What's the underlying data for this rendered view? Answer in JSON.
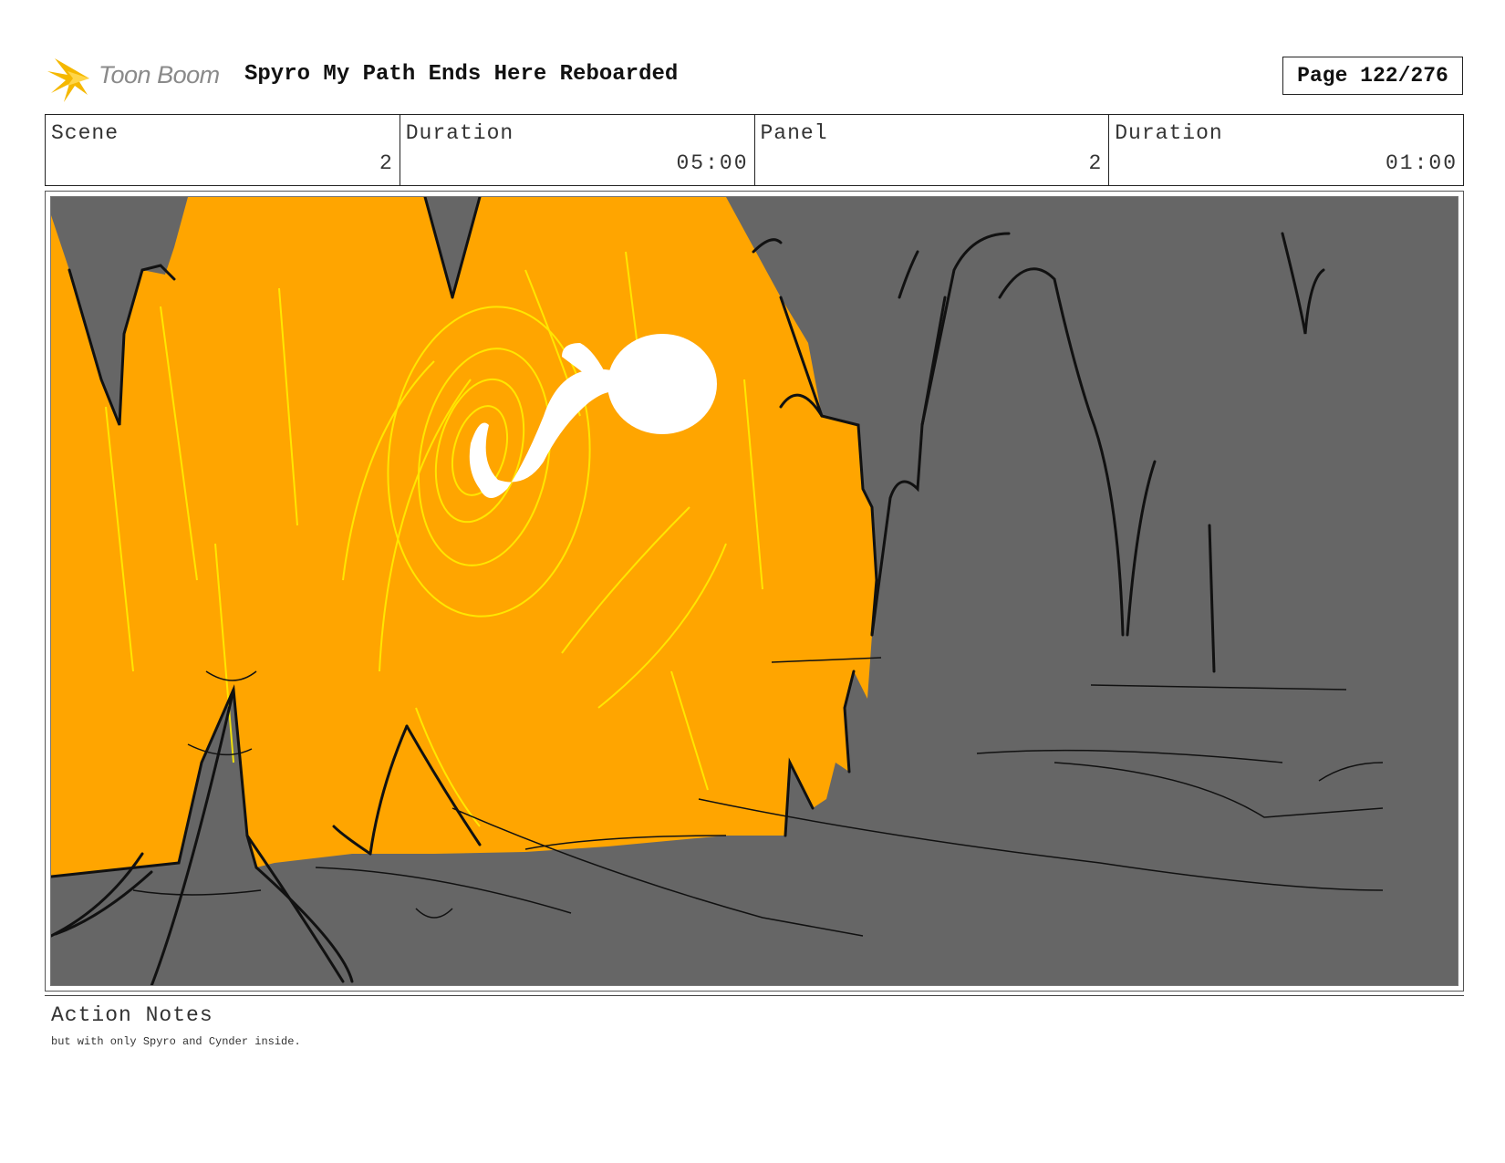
{
  "header": {
    "logo_text": "Toon Boom",
    "project_title": "Spyro My Path Ends Here Reboarded",
    "page_label": "Page 122/276"
  },
  "info": {
    "scene_label": "Scene",
    "scene_value": "2",
    "scene_duration_label": "Duration",
    "scene_duration_value": "05:00",
    "panel_label": "Panel",
    "panel_value": "2",
    "panel_duration_label": "Duration",
    "panel_duration_value": "01:00"
  },
  "notes": {
    "label": "Action Notes",
    "text": "but with only Spyro and Cynder inside."
  },
  "colors": {
    "sky_orange": "#FFA500",
    "rock_gray": "#666666",
    "glow_yellow": "#FFEE00",
    "spirit_white": "#FFFFFF",
    "logo_gold": "#F5B800"
  },
  "icons": {
    "logo": "toon-boom-star-icon"
  }
}
